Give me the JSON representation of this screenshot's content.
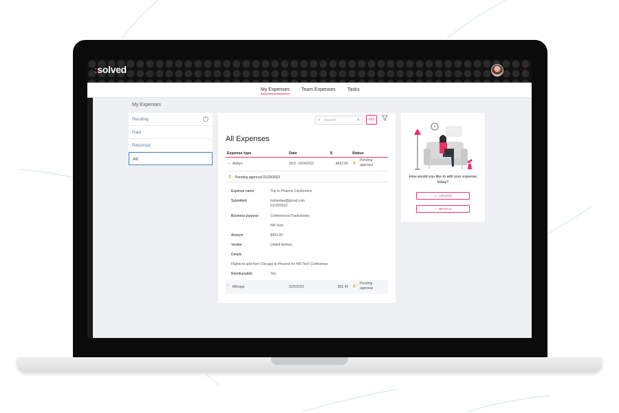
{
  "app": {
    "logo_prefix": ":",
    "logo_name": "solved"
  },
  "nav": {
    "tabs": [
      {
        "label": "My Expenses"
      },
      {
        "label": "Team Expenses"
      },
      {
        "label": "Tasks"
      }
    ]
  },
  "sidebar": {
    "title": "My Expenses",
    "items": [
      {
        "label": "Pending"
      },
      {
        "label": "Paid"
      },
      {
        "label": "Returned"
      },
      {
        "label": "All"
      }
    ],
    "help_glyph": "?"
  },
  "search": {
    "placeholder": "Search",
    "go_label": "GO"
  },
  "main": {
    "title": "All Expenses",
    "columns": [
      "Expense type",
      "Date",
      "$",
      "Status"
    ],
    "rows": [
      {
        "type": "Airfare",
        "date": "02/3 - 02/4/2022",
        "amount": "$452.00",
        "status": [
          "Pending",
          "approval"
        ]
      },
      {
        "type": "Mileage",
        "date": "02/5/2022",
        "amount": "$53.46",
        "status": [
          "Pending",
          "approval"
        ]
      }
    ],
    "pending_banner": "Pending approval 01/20/2022",
    "details": {
      "expense_name_label": "Expense name",
      "expense_name": "Trip to Phoenix Conference",
      "submitted_label": "Submitted",
      "submitted_email": "isolvedaw@gmail.com",
      "submitted_date": "01/20/2022",
      "business_purpose_label": "Business purpose",
      "business_purpose": "Conferences/Tradeshows",
      "business_purpose_2": "HR Tech",
      "amount_label": "Amount",
      "amount": "$452.00",
      "vendor_label": "Vendor",
      "vendor": "United Airlines",
      "details_label": "Details",
      "details_text": "Flights to and from Chicago to Phoenix for HR Tech Conference",
      "reimbursable_label": "Reimbursable",
      "reimbursable": "Yes"
    }
  },
  "add_expense": {
    "question": "How would you like to add your expense today?",
    "upload_label": "UPLOAD",
    "details_label": "DETAILS"
  },
  "colors": {
    "accent": "#e8336b",
    "pending": "#e0a324",
    "link": "#5b7fa6"
  }
}
